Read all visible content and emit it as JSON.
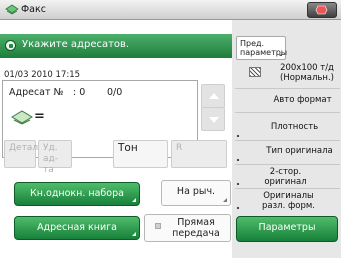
{
  "header": {
    "title": "Факс",
    "system_icon": "status-monitor-icon"
  },
  "status": {
    "message": "Укажите адресатов."
  },
  "recipients": {
    "datetime": "01/03 2010 17:15",
    "label": "Адресат №",
    "count": ": 0",
    "total": "0/0",
    "icon_suffix": "="
  },
  "keys": [
    {
      "label": "Детали"
    },
    {
      "label": "Уд. ад-та"
    },
    {
      "label": "Тон"
    },
    {
      "label": "R"
    }
  ],
  "buttons": {
    "onetouch": "Кн.однокн. набора",
    "onhook": "На рыч.",
    "addressbook": "Адресная книга",
    "direct_tx": "Прямая передача"
  },
  "settings": {
    "presets": "Пред. параметры",
    "resolution": "200x100 т/д (Нормальн.)",
    "auto_format": "Авто формат",
    "density": "Плотность",
    "original_type": "Тип оригинала",
    "duplex": "2-стор. оригинал",
    "mixed": "Оригиналы разл. форм.",
    "params": "Параметры"
  },
  "colors": {
    "accent_green": "#1f7d3c",
    "disabled_text": "#b2b2b2"
  }
}
